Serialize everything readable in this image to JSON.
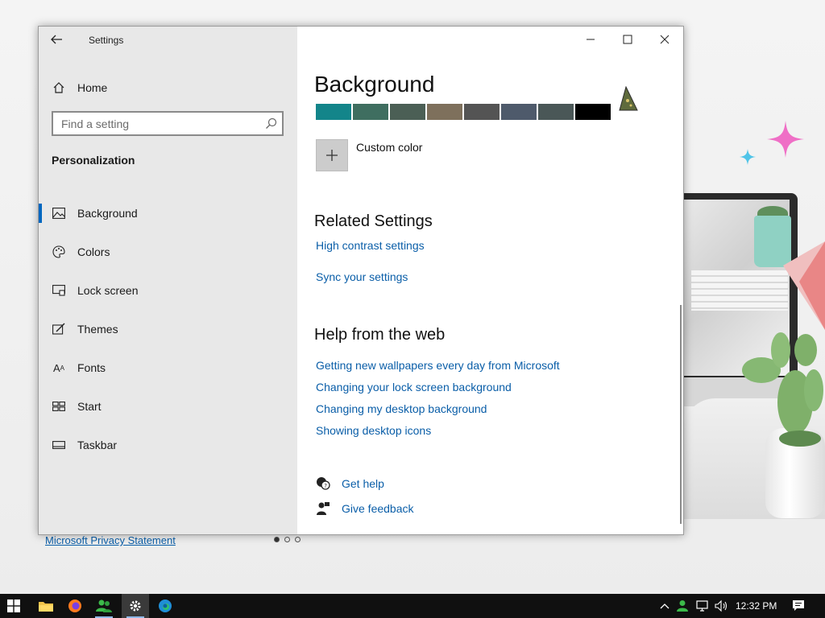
{
  "window": {
    "app_title": "Settings",
    "back_label": "←"
  },
  "sidebar": {
    "home_label": "Home",
    "search_placeholder": "Find a setting",
    "section_title": "Personalization",
    "items": [
      {
        "label": "Background",
        "icon": "picture-icon",
        "active": true
      },
      {
        "label": "Colors",
        "icon": "palette-icon",
        "active": false
      },
      {
        "label": "Lock screen",
        "icon": "lock-screen-icon",
        "active": false
      },
      {
        "label": "Themes",
        "icon": "themes-icon",
        "active": false
      },
      {
        "label": "Fonts",
        "icon": "fonts-icon",
        "active": false
      },
      {
        "label": "Start",
        "icon": "start-icon",
        "active": false
      },
      {
        "label": "Taskbar",
        "icon": "taskbar-icon",
        "active": false
      }
    ]
  },
  "main": {
    "title": "Background",
    "swatches": [
      "#13858a",
      "#3f6e60",
      "#4b5f55",
      "#7e705c",
      "#545454",
      "#4e5a6b",
      "#4a5757",
      "#000000"
    ],
    "custom_color_label": "Custom color",
    "related_heading": "Related Settings",
    "related_links": [
      "High contrast settings",
      "Sync your settings"
    ],
    "help_heading": "Help from the web",
    "help_links": [
      "Getting new wallpapers every day from Microsoft",
      "Changing your lock screen background",
      "Changing my desktop background",
      "Showing desktop icons"
    ],
    "get_help_label": "Get help",
    "give_feedback_label": "Give feedback"
  },
  "desktop": {
    "privacy_link": "Microsoft Privacy Statement",
    "carousel_dots": 3,
    "carousel_active": 0
  },
  "taskbar": {
    "clock": "12:32 PM"
  },
  "colors": {
    "accent": "#0067c0",
    "link": "#0a5ea8"
  }
}
